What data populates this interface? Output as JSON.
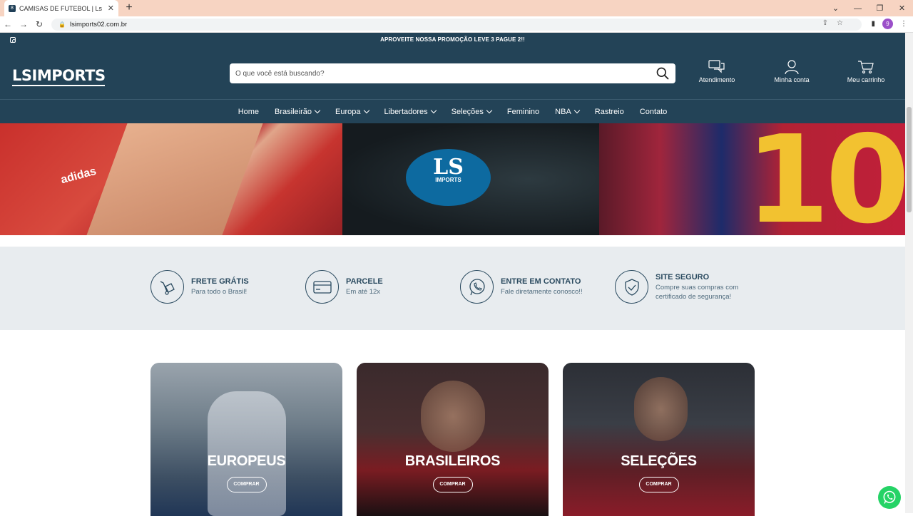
{
  "browser": {
    "tab_title": "CAMISAS DE FUTEBOL | Ls Impor",
    "url": "lsimports02.com.br",
    "profile_initial": "9"
  },
  "promo": {
    "text": "APROVEITE NOSSA PROMOÇÃO LEVE 3 PAGUE 2!!"
  },
  "header": {
    "logo": "LSIMPORTS",
    "search_placeholder": "O que você está buscando?",
    "actions": {
      "support": "Atendimento",
      "account": "Minha conta",
      "cart": "Meu carrinho"
    }
  },
  "nav": {
    "items": [
      "Home",
      "Brasileirão",
      "Europa",
      "Libertadores",
      "Seleções",
      "Feminino",
      "NBA",
      "Rastreio",
      "Contato"
    ]
  },
  "hero": {
    "badge_top": "LS",
    "badge_bottom": "IMPORTS",
    "jersey_number": "10",
    "brand_text": "adidas"
  },
  "benefits": [
    {
      "title": "FRETE GRÁTIS",
      "subtitle": "Para todo o Brasil!",
      "icon": "delivery-icon"
    },
    {
      "title": "PARCELE",
      "subtitle": "Em até 12x",
      "icon": "credit-card-icon"
    },
    {
      "title": "ENTRE EM CONTATO",
      "subtitle": "Fale diretamente conosco!!",
      "icon": "whatsapp-icon"
    },
    {
      "title": "SITE SEGURO",
      "subtitle": "Compre suas compras com certificado de segurança!",
      "icon": "shield-check-icon"
    }
  ],
  "categories": [
    {
      "title": "EUROPEUS",
      "button": "COMPRAR"
    },
    {
      "title": "BRASILEIROS",
      "button": "COMPRAR"
    },
    {
      "title": "SELEÇÕES",
      "button": "COMPRAR"
    }
  ],
  "colors": {
    "header_bg": "#234357",
    "benefits_bg": "#e8ecef",
    "accent": "#2a4a5f",
    "whatsapp": "#25d366"
  }
}
